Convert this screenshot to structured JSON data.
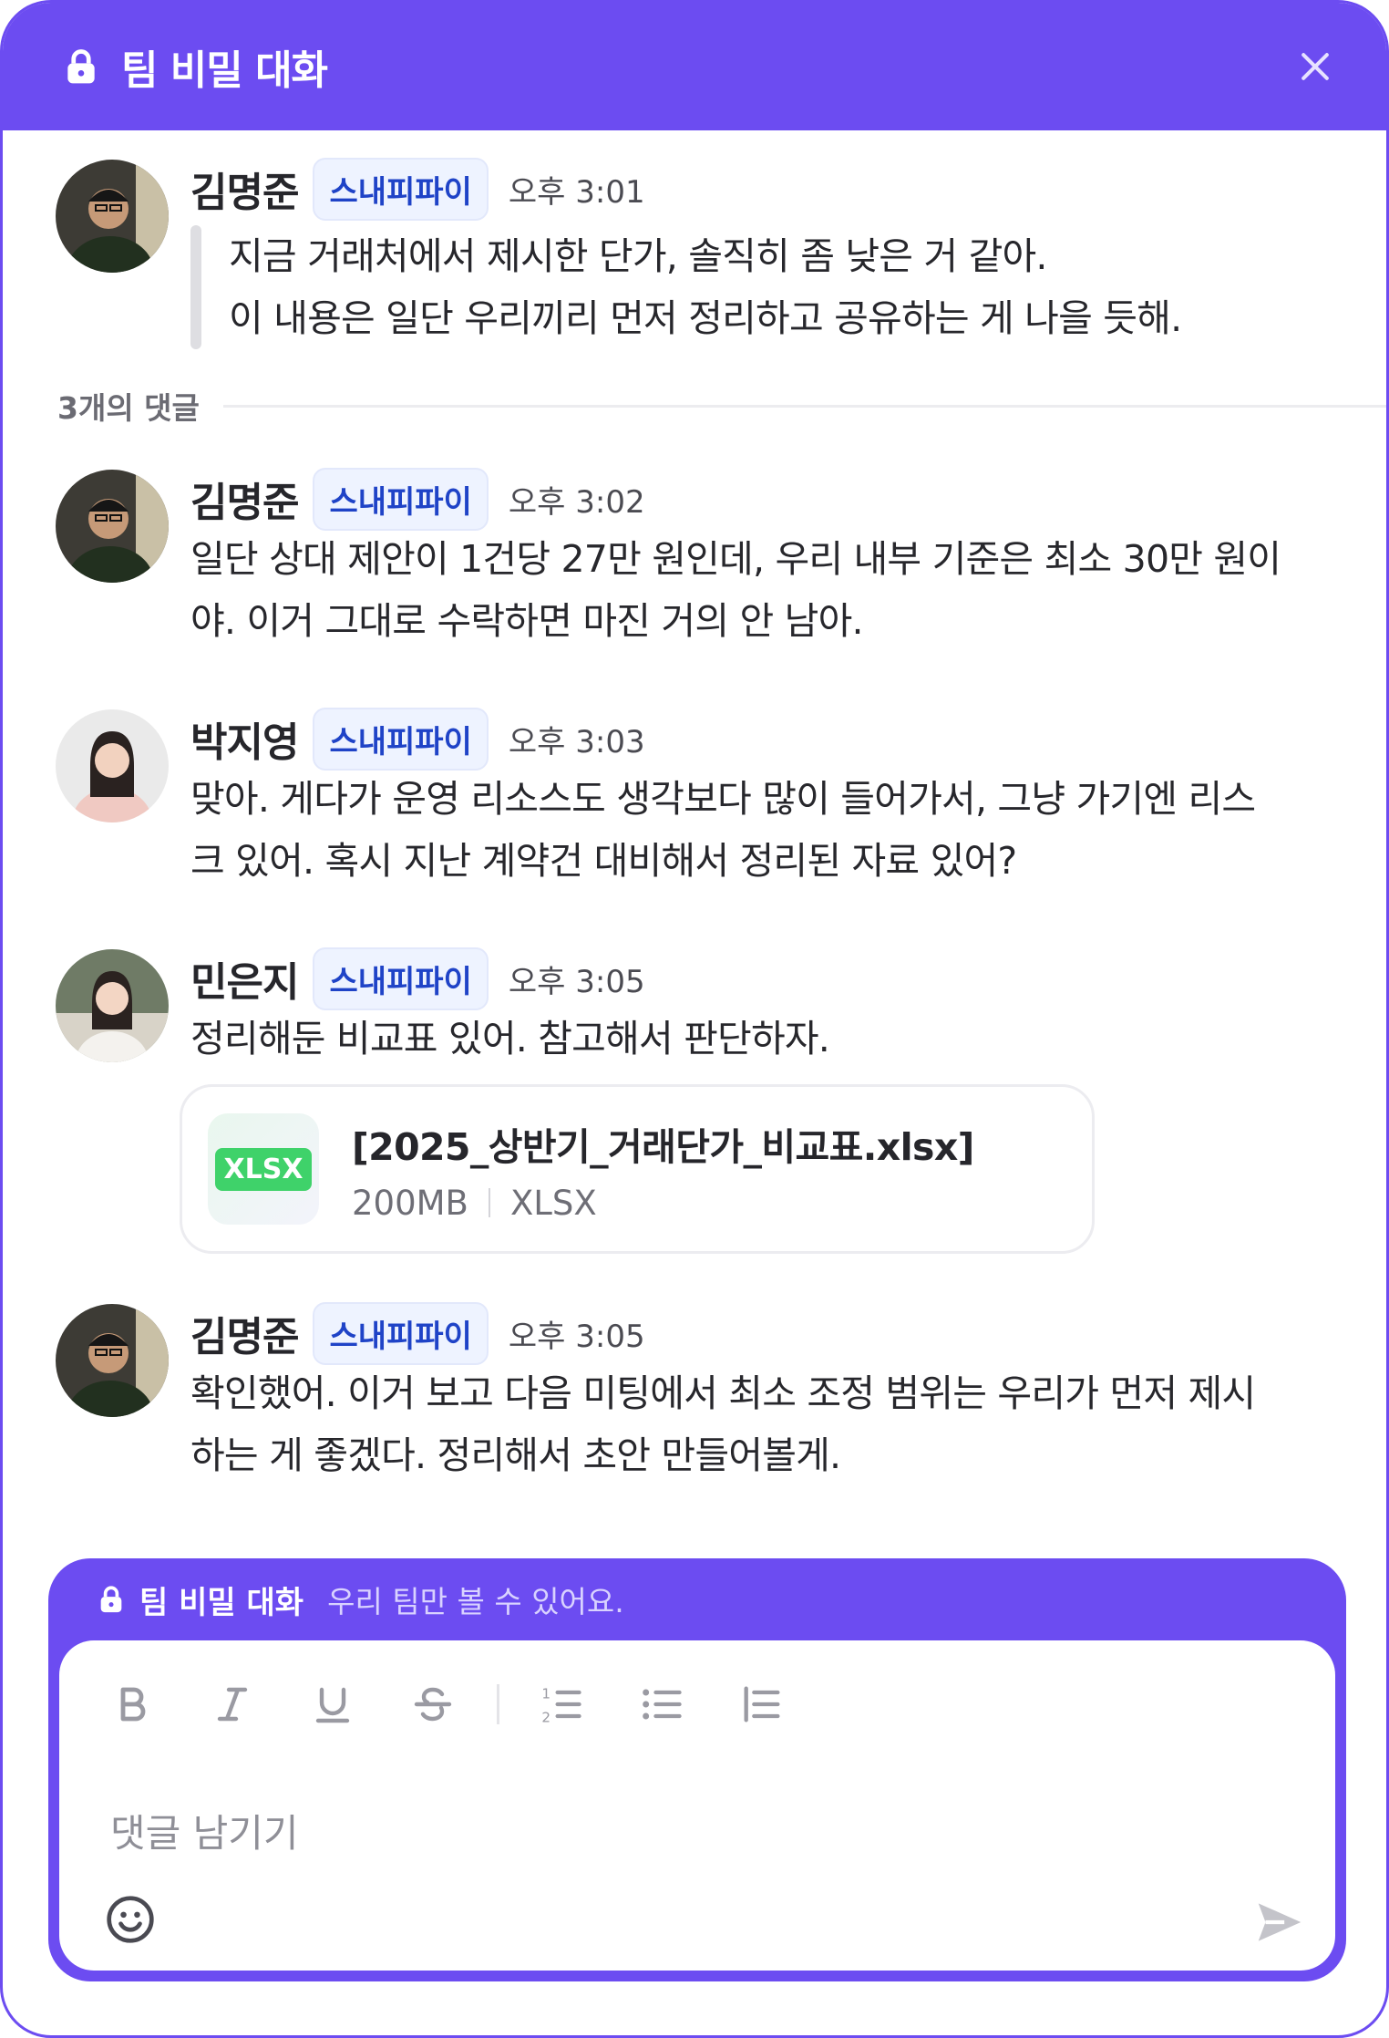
{
  "header": {
    "title": "팀 비밀 대화"
  },
  "thread": {
    "name": "김명준",
    "badge": "스내피파이",
    "time": "오후 3:01",
    "line1": "지금 거래처에서 제시한 단가, 솔직히 좀 낮은 거 같아.",
    "line2": "이 내용은 일단 우리끼리 먼저 정리하고 공유하는 게 나을 듯해."
  },
  "replies_label": "3개의 댓글",
  "replies": [
    {
      "name": "김명준",
      "badge": "스내피파이",
      "time": "오후 3:02",
      "line1": "일단 상대 제안이 1건당 27만 원인데, 우리 내부 기준은 최소 30만 원이",
      "line2": "야. 이거 그대로 수락하면 마진 거의 안 남아."
    },
    {
      "name": "박지영",
      "badge": "스내피파이",
      "time": "오후 3:03",
      "line1": "맞아. 게다가 운영 리소스도 생각보다 많이 들어가서, 그냥 가기엔 리스",
      "line2": "크 있어. 혹시 지난 계약건 대비해서 정리된 자료 있어?"
    },
    {
      "name": "민은지",
      "badge": "스내피파이",
      "time": "오후 3:05",
      "line1": "정리해둔 비교표 있어. 참고해서 판단하자."
    },
    {
      "name": "김명준",
      "badge": "스내피파이",
      "time": "오후 3:05",
      "line1": "확인했어. 이거 보고 다음 미팅에서 최소 조정 범위는 우리가 먼저 제시",
      "line2": "하는 게 좋겠다. 정리해서 초안 만들어볼게."
    }
  ],
  "attachment": {
    "icon_label": "XLSX",
    "filename": "[2025_상반기_거래단가_비교표.xlsx]",
    "size": "200MB",
    "type": "XLSX"
  },
  "composer": {
    "title": "팀 비밀 대화",
    "subtitle": "우리 팀만 볼 수 있어요.",
    "placeholder": "댓글 남기기"
  },
  "icons": {
    "header": [
      "lock-icon",
      "close-icon"
    ],
    "toolbar": [
      "bold-icon",
      "italic-icon",
      "underline-icon",
      "strikethrough-icon",
      "ordered-list-icon",
      "bullet-list-icon",
      "indent-icon"
    ],
    "composer": [
      "emoji-icon",
      "send-icon"
    ]
  },
  "colors": {
    "accent": "#6c4cf1",
    "badge_bg": "#eef3ff",
    "badge_text": "#1f43c7",
    "xlsx_green": "#3fd26a"
  }
}
